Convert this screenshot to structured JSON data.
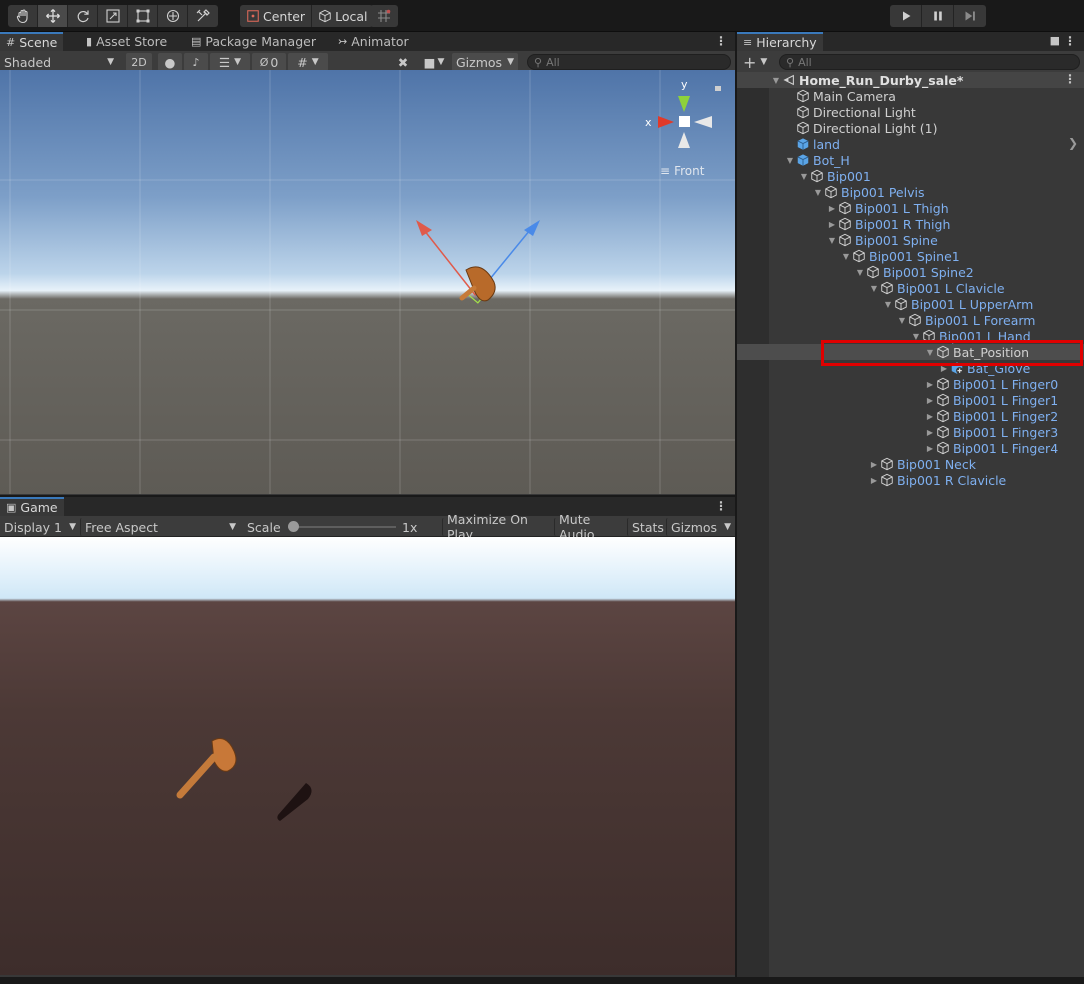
{
  "toolbar": {
    "pivot_label": "Center",
    "space_label": "Local",
    "tools": [
      "hand-tool-icon",
      "move-tool-icon",
      "rotate-tool-icon",
      "scale-tool-icon",
      "rect-tool-icon",
      "transform-tool-icon",
      "custom-tool-icon"
    ],
    "play_controls": [
      "play-icon",
      "pause-icon",
      "step-icon"
    ]
  },
  "scene_panel": {
    "tabs": [
      {
        "label": "Scene",
        "icon": "grid-icon",
        "active": true
      },
      {
        "label": "Asset Store",
        "icon": "bag-icon",
        "active": false
      },
      {
        "label": "Package Manager",
        "icon": "package-icon",
        "active": false
      },
      {
        "label": "Animator",
        "icon": "animator-icon",
        "active": false
      }
    ],
    "draw_mode": "Shaded",
    "mode_2d": "2D",
    "hidden_count": "0",
    "gizmos_label": "Gizmos",
    "search_placeholder": "All",
    "gizmo_axis_x": "x",
    "gizmo_axis_y": "y",
    "view_label": "Front"
  },
  "game_panel": {
    "tab_label": "Game",
    "display": "Display 1",
    "aspect": "Free Aspect",
    "scale_label": "Scale",
    "scale_value": "1x",
    "scale_fraction": 0.0,
    "maximize_label": "Maximize On Play",
    "mute_label": "Mute Audio",
    "stats_label": "Stats",
    "gizmos_label": "Gizmos"
  },
  "hierarchy": {
    "tab_label": "Hierarchy",
    "search_placeholder": "All",
    "items": [
      {
        "label": "Home_Run_Durby_sale*",
        "depth": 0,
        "arrow": "down",
        "kind": "scene",
        "blue": false
      },
      {
        "label": "Main Camera",
        "depth": 1,
        "arrow": "",
        "kind": "cube",
        "blue": false
      },
      {
        "label": "Directional Light",
        "depth": 1,
        "arrow": "",
        "kind": "cube",
        "blue": false
      },
      {
        "label": "Directional Light (1)",
        "depth": 1,
        "arrow": "",
        "kind": "cube",
        "blue": false
      },
      {
        "label": "land",
        "depth": 1,
        "arrow": "",
        "kind": "prefab",
        "blue": true
      },
      {
        "label": "Bot_H",
        "depth": 1,
        "arrow": "down",
        "kind": "prefab",
        "blue": true
      },
      {
        "label": "Bip001",
        "depth": 2,
        "arrow": "down",
        "kind": "cube",
        "blue": true
      },
      {
        "label": "Bip001 Pelvis",
        "depth": 3,
        "arrow": "down",
        "kind": "cube",
        "blue": true
      },
      {
        "label": "Bip001 L Thigh",
        "depth": 4,
        "arrow": "right",
        "kind": "cube",
        "blue": true
      },
      {
        "label": "Bip001 R Thigh",
        "depth": 4,
        "arrow": "right",
        "kind": "cube",
        "blue": true
      },
      {
        "label": "Bip001 Spine",
        "depth": 4,
        "arrow": "down",
        "kind": "cube",
        "blue": true
      },
      {
        "label": "Bip001 Spine1",
        "depth": 5,
        "arrow": "down",
        "kind": "cube",
        "blue": true
      },
      {
        "label": "Bip001 Spine2",
        "depth": 6,
        "arrow": "down",
        "kind": "cube",
        "blue": true
      },
      {
        "label": "Bip001 L Clavicle",
        "depth": 7,
        "arrow": "down",
        "kind": "cube",
        "blue": true
      },
      {
        "label": "Bip001 L UpperArm",
        "depth": 8,
        "arrow": "down",
        "kind": "cube",
        "blue": true
      },
      {
        "label": "Bip001 L Forearm",
        "depth": 9,
        "arrow": "down",
        "kind": "cube",
        "blue": true
      },
      {
        "label": "Bip001 L Hand",
        "depth": 10,
        "arrow": "down",
        "kind": "cube",
        "blue": true
      },
      {
        "label": "Bat_Position",
        "depth": 11,
        "arrow": "down",
        "kind": "cube",
        "blue": false,
        "selected": true
      },
      {
        "label": "Bat_Glove",
        "depth": 12,
        "arrow": "right",
        "kind": "prefab-mod",
        "blue": true
      },
      {
        "label": "Bip001 L Finger0",
        "depth": 11,
        "arrow": "right",
        "kind": "cube",
        "blue": true
      },
      {
        "label": "Bip001 L Finger1",
        "depth": 11,
        "arrow": "right",
        "kind": "cube",
        "blue": true
      },
      {
        "label": "Bip001 L Finger2",
        "depth": 11,
        "arrow": "right",
        "kind": "cube",
        "blue": true
      },
      {
        "label": "Bip001 L Finger3",
        "depth": 11,
        "arrow": "right",
        "kind": "cube",
        "blue": true
      },
      {
        "label": "Bip001 L Finger4",
        "depth": 11,
        "arrow": "right",
        "kind": "cube",
        "blue": true
      },
      {
        "label": "Bip001 Neck",
        "depth": 7,
        "arrow": "right",
        "kind": "cube",
        "blue": true
      },
      {
        "label": "Bip001 R Clavicle",
        "depth": 7,
        "arrow": "right",
        "kind": "cube",
        "blue": true
      }
    ]
  },
  "colors": {
    "highlight_box": "#e00000",
    "prefab_text": "#7fb0f0",
    "tab_accent": "#3a79bb"
  }
}
